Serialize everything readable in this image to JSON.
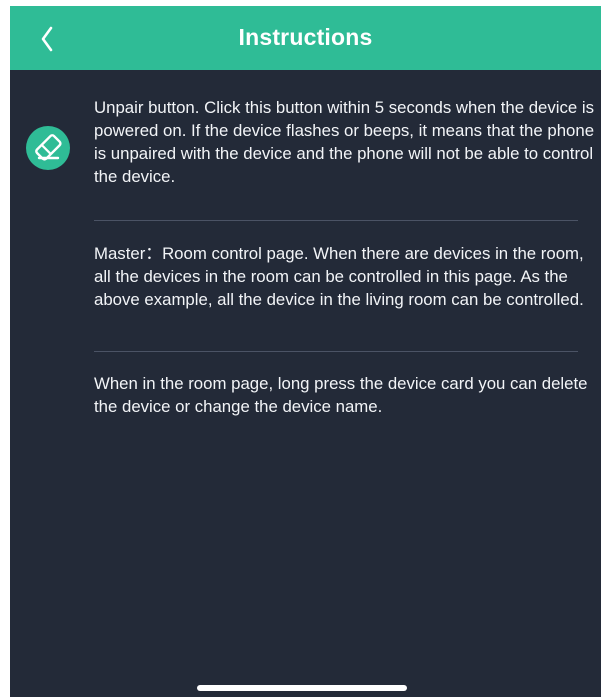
{
  "header": {
    "title": "Instructions",
    "back_icon": "chevron-left-icon"
  },
  "sections": [
    {
      "icon": "eraser-icon",
      "text": "Unpair button. Click this button within 5 seconds when the device is powered on. If the device flashes or beeps, it means that the phone is unpaired with the device and the phone will not be able to control the device."
    },
    {
      "text": "Master：Room control page. When there are devices in the room, all the devices in the room can be controlled in this page. As the above example, all the device in the living room can be controlled."
    },
    {
      "text": "When in the room page, long press the device card you can delete the device or change the device name."
    }
  ],
  "colors": {
    "accent": "#2fbc96",
    "background": "#232a38",
    "text": "#f2f4f7",
    "divider": "#4b5365"
  }
}
